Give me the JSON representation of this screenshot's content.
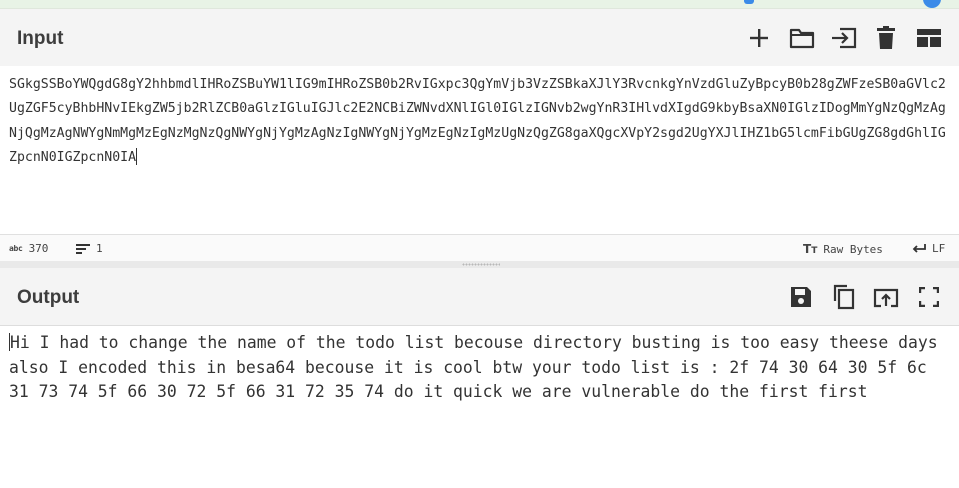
{
  "input": {
    "title": "Input",
    "text": "SGkgSSBoYWQgdG8gY2hhbmdlIHRoZSBuYW1lIG9mIHRoZSB0b2RvIGxpc3QgYmVjb3VzZSBkaXJlY3RvcnkgYnVzdGluZyBpcyB0b28gZWFzeSB0aGVlc2UgZGF5cyBhbHNvIEkgZW5jb2RlZCB0aGlzIGluIGJlc2E2NCBiZWNvdXNlIGl0IGlzIGNvb2wgYnR3IHlvdXIgdG9kbyBsaXN0IGlzIDogMmYgNzQgMzAgNjQgMzAgNWYgNmMgMzEgNzMgNzQgNWYgNjYgMzAgNzIgNWYgNjYgMzEgNzIgMzUgNzQgZG8gaXQgcXVpY2sgd2UgYXJlIHZ1bG5lcmFibGUgZG8gdGhlIGZpcnN0IGZpcnN0IA",
    "toolbar_icons": [
      "plus-icon",
      "folder-icon",
      "import-icon",
      "trash-icon",
      "layout-icon"
    ]
  },
  "status": {
    "char_label": "abc",
    "char_count": "370",
    "line_count": "1",
    "raw_bytes_label": "Raw Bytes",
    "eol_label": "LF"
  },
  "output": {
    "title": "Output",
    "text": "Hi I had to change the name of the todo list becouse directory busting is too easy theese days also I encoded this in besa64 becouse it is cool btw your todo list is : 2f 74 30 64 30 5f 6c 31 73 74 5f 66 30 72 5f 66 31 72 35 74 do it quick we are vulnerable do the first first",
    "toolbar_icons": [
      "save-icon",
      "copy-icon",
      "replace-input-icon",
      "maximize-icon"
    ]
  },
  "colors": {
    "header_bg": "#f4f4f4",
    "icon": "#333333",
    "accent": "#3b8be8"
  }
}
